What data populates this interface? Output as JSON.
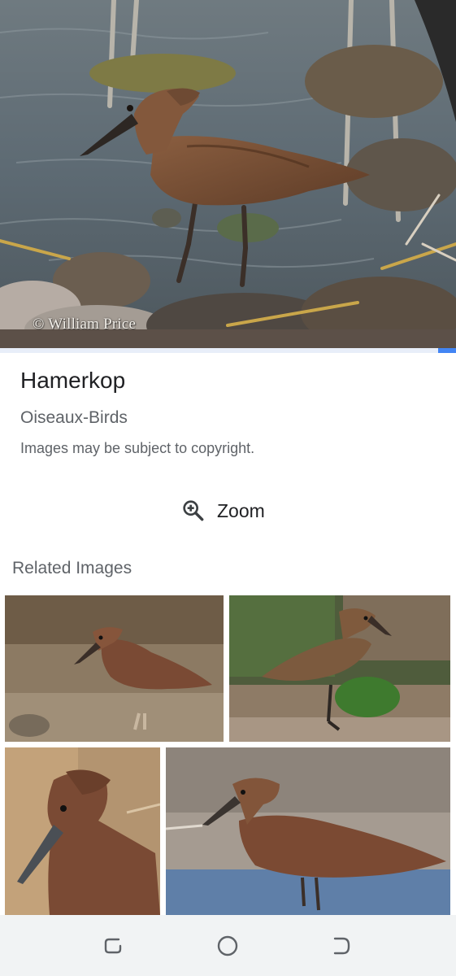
{
  "main_image": {
    "subject": "Hamerkop",
    "watermark": "© William Price"
  },
  "image_progress": 0.04,
  "result": {
    "title": "Hamerkop",
    "source": "Oiseaux-Birds",
    "copyright_notice": "Images may be subject to copyright."
  },
  "zoom": {
    "label": "Zoom",
    "icon": "zoom-in-icon"
  },
  "related": {
    "heading": "Related Images",
    "items": [
      {
        "subject": "Hamerkop"
      },
      {
        "subject": "Hamerkop"
      },
      {
        "subject": "Hamerkop"
      },
      {
        "subject": "Hamerkop"
      }
    ]
  },
  "nav_bar": {
    "buttons": [
      "recents-icon",
      "home-icon",
      "back-icon"
    ]
  },
  "colors": {
    "accent": "#4285f4",
    "title_text": "#202124",
    "secondary_text": "#5f6368",
    "nav_bar_bg": "#f1f3f4",
    "bird_brown": "#7a5238"
  }
}
